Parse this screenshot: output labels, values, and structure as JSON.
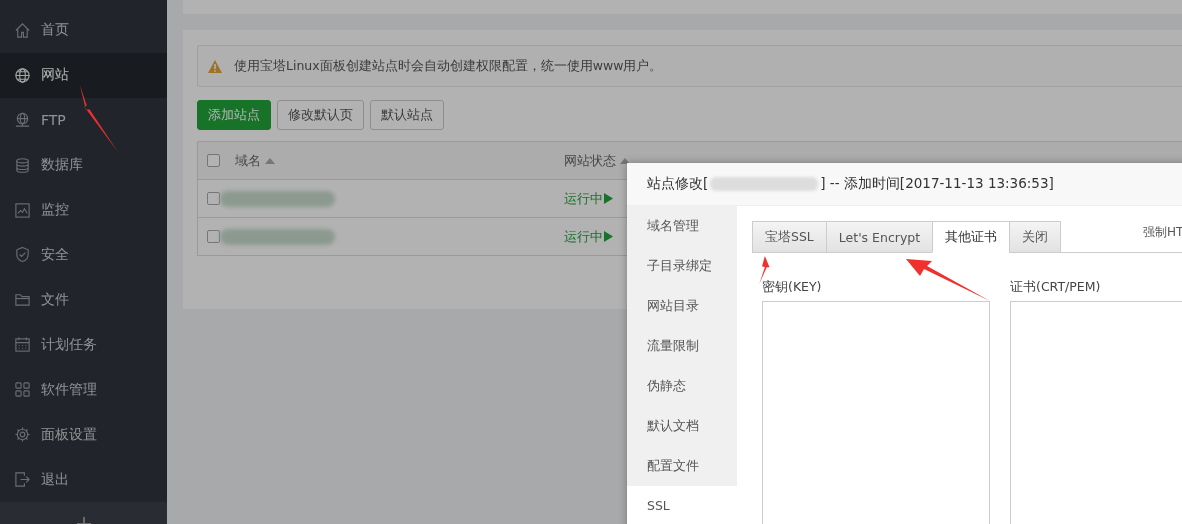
{
  "sidebar": {
    "items": [
      {
        "label": "首页",
        "selected": false
      },
      {
        "label": "网站",
        "selected": true
      },
      {
        "label": "FTP",
        "selected": false
      },
      {
        "label": "数据库",
        "selected": false
      },
      {
        "label": "监控",
        "selected": false
      },
      {
        "label": "安全",
        "selected": false
      },
      {
        "label": "文件",
        "selected": false
      },
      {
        "label": "计划任务",
        "selected": false
      },
      {
        "label": "软件管理",
        "selected": false
      },
      {
        "label": "面板设置",
        "selected": false
      },
      {
        "label": "退出",
        "selected": false
      }
    ]
  },
  "alert": {
    "text": "使用宝塔Linux面板创建站点时会自动创建权限配置，统一使用www用户。"
  },
  "buttons": [
    {
      "label": "添加站点",
      "kind": "primary"
    },
    {
      "label": "修改默认页",
      "kind": "default"
    },
    {
      "label": "默认站点",
      "kind": "default"
    }
  ],
  "table": {
    "select_all": {
      "checked": false
    },
    "columns": [
      {
        "label": "域名",
        "sortable": true
      },
      {
        "label": "网站状态",
        "sortable": true
      }
    ],
    "rows": [
      {
        "checked": false,
        "status": "运行中"
      },
      {
        "checked": false,
        "status": "运行中"
      }
    ]
  },
  "dialog": {
    "title_prefix": "站点修改[",
    "title_suffix": "] -- 添加时间[2017-11-13 13:36:53]",
    "nav": [
      {
        "label": "域名管理",
        "selected": false
      },
      {
        "label": "子目录绑定",
        "selected": false
      },
      {
        "label": "网站目录",
        "selected": false
      },
      {
        "label": "流量限制",
        "selected": false
      },
      {
        "label": "伪静态",
        "selected": false
      },
      {
        "label": "默认文档",
        "selected": false
      },
      {
        "label": "配置文件",
        "selected": false
      },
      {
        "label": "SSL",
        "selected": true
      }
    ],
    "tabs": [
      {
        "label": "宝塔SSL",
        "selected": false
      },
      {
        "label": "Let's Encrypt",
        "selected": false
      },
      {
        "label": "其他证书",
        "selected": true
      },
      {
        "label": "关闭",
        "selected": false
      }
    ],
    "force_https_label": "强制HT",
    "fields": [
      {
        "label": "密钥(KEY)"
      },
      {
        "label": "证书(CRT/PEM)"
      }
    ]
  }
}
